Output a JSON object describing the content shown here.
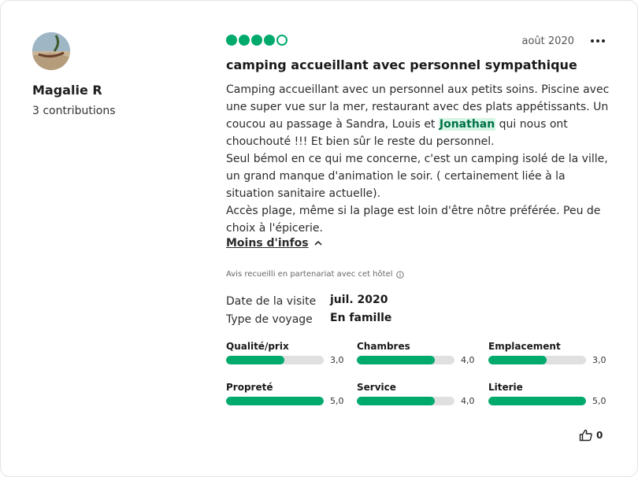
{
  "user": {
    "name": "Magalie R",
    "contributions": "3 contributions"
  },
  "review": {
    "rating": 4,
    "rating_max": 5,
    "date": "août 2020",
    "title": "camping accueillant avec personnel sympathique",
    "body": {
      "p1_before": "Camping accueillant avec un personnel aux petits soins. Piscine avec une super vue sur la mer, restaurant  avec des plats appétissants. Un coucou au passage à Sandra, Louis et ",
      "mention": "Jonathan",
      "p1_after": " qui nous ont chouchouté !!! Et bien sûr le reste du personnel.",
      "p2": "Seul bémol en ce qui me concerne, c'est un camping  isolé de la ville, un grand manque d'animation le soir. ( certainement liée  à la situation sanitaire actuelle).",
      "p3": "Accès plage, même si la plage est loin d'être nôtre préférée.  Peu de choix à l'épicerie."
    },
    "toggle_label": "Moins d'infos",
    "partner_note": "Avis recueilli en partenariat avec cet hôtel",
    "visit_label": "Date de la visite",
    "visit_value": "juil. 2020",
    "trip_label": "Type de voyage",
    "trip_value": "En famille",
    "subratings": [
      {
        "label": "Qualité/prix",
        "value": 3.0,
        "display": "3,0"
      },
      {
        "label": "Chambres",
        "value": 4.0,
        "display": "4,0"
      },
      {
        "label": "Emplacement",
        "value": 3.0,
        "display": "3,0"
      },
      {
        "label": "Propreté",
        "value": 5.0,
        "display": "5,0"
      },
      {
        "label": "Service",
        "value": 4.0,
        "display": "4,0"
      },
      {
        "label": "Literie",
        "value": 5.0,
        "display": "5,0"
      }
    ],
    "helpful_count": "0"
  },
  "colors": {
    "accent": "#00aa6c",
    "mention_bg": "#d5f5e4",
    "bar_bg": "#e0e0e0"
  },
  "icons": {
    "more": "more-horizontal-icon",
    "chevron": "chevron-up-icon",
    "info": "info-icon",
    "helpful": "thumbs-up-icon"
  }
}
